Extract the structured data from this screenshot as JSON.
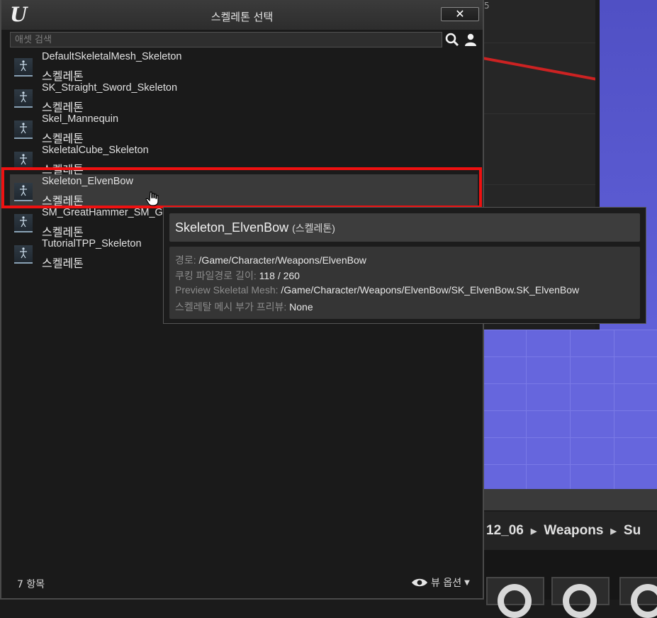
{
  "background": {
    "graph_value": "5",
    "breadcrumb": [
      "12_06",
      "Weapons",
      "Su"
    ]
  },
  "dialog": {
    "title": "스켈레톤 선택",
    "close_label": "✕",
    "search_placeholder": "애셋 검색",
    "item_count": "7 항목",
    "view_options_label": "뷰 옵션"
  },
  "assets": [
    {
      "name": "DefaultSkeletalMesh_Skeleton",
      "type": "스켈레톤"
    },
    {
      "name": "SK_Straight_Sword_Skeleton",
      "type": "스켈레톤"
    },
    {
      "name": "Skel_Mannequin",
      "type": "스켈레톤"
    },
    {
      "name": "SkeletalCube_Skeleton",
      "type": "스켈레톤"
    },
    {
      "name": "Skeleton_ElvenBow",
      "type": "스켈레톤",
      "selected": true
    },
    {
      "name": "SM_GreatHammer_SM_G",
      "type": "스켈레톤"
    },
    {
      "name": "TutorialTPP_Skeleton",
      "type": "스켈레톤"
    }
  ],
  "tooltip": {
    "title": "Skeleton_ElvenBow",
    "type": "(스켈레톤)",
    "rows": [
      {
        "label": "경로:",
        "value": "/Game/Character/Weapons/ElvenBow"
      },
      {
        "label": "쿠킹 파일경로 길이:",
        "value": "118 / 260"
      },
      {
        "label": "Preview Skeletal Mesh:",
        "value": "/Game/Character/Weapons/ElvenBow/SK_ElvenBow.SK_ElvenBow"
      },
      {
        "label": "스켈레탈 메시 부가 프리뷰:",
        "value": "None"
      }
    ]
  },
  "colors": {
    "highlight": "#ee1111",
    "viewport": "#6666dd"
  }
}
